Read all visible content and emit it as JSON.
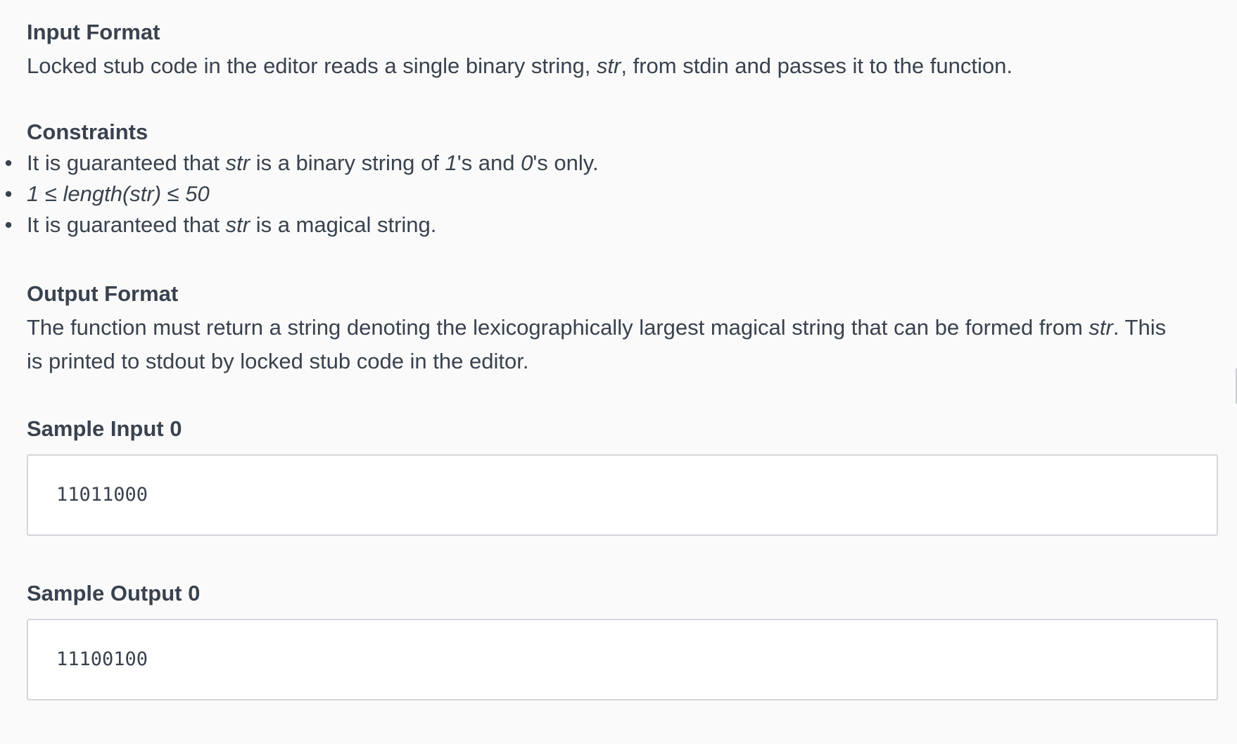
{
  "input_format": {
    "heading": "Input Format",
    "text_before": "Locked stub code in the editor reads a single binary string, ",
    "text_var": "str",
    "text_after": ", from stdin and passes it to the function."
  },
  "constraints": {
    "heading": "Constraints",
    "bullet": "•",
    "items": [
      {
        "p1": "It is guaranteed that ",
        "v1": "str",
        "p2": " is a binary string of ",
        "v2": "1",
        "p3": "'s and ",
        "v3": "0",
        "p4": "'s only."
      },
      {
        "math": "1 ≤ length(str) ≤ 50"
      },
      {
        "p1": "It is guaranteed that ",
        "v1": "str",
        "p2": " is a magical string."
      }
    ]
  },
  "output_format": {
    "heading": "Output Format",
    "line1_before": "The function must return a string denoting the lexicographically largest magical string that can be formed from ",
    "line1_var": "str",
    "line1_after": ". This",
    "line2": "is printed to stdout by locked stub code in the editor."
  },
  "sample_input": {
    "heading": "Sample Input 0",
    "code": "11011000"
  },
  "sample_output": {
    "heading": "Sample Output 0",
    "code": "11100100"
  },
  "colors": {
    "background": "#fafafa",
    "text": "#39424e",
    "code_border": "#d3d6db",
    "code_background": "#ffffff"
  }
}
